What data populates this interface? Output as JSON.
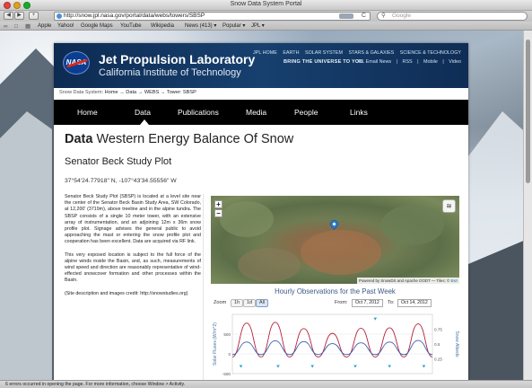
{
  "window": {
    "title": "Snow Data System Portal"
  },
  "toolbar": {
    "back": "◀",
    "forward": "▶",
    "add_bookmark": "+",
    "url": "http://snow.jpl.nasa.gov/portal/data/webs/towers/SBSP",
    "rss": "RSS",
    "reload": "C",
    "search_placeholder": "Google"
  },
  "bookmarks": {
    "items": [
      "Apple",
      "Yahoo!",
      "Google Maps",
      "YouTube",
      "Wikipedia",
      "News (413) ▾",
      "Popular ▾",
      "JPL ▾"
    ]
  },
  "header": {
    "logo_text": "NASA",
    "org_name": "Jet Propulsion Laboratory",
    "org_sub": "California Institute of Technology",
    "top_links": [
      "JPL HOME",
      "EARTH",
      "SOLAR SYSTEM",
      "STARS & GALAXIES",
      "SCIENCE & TECHNOLOGY"
    ],
    "tagline": "BRING THE UNIVERSE TO YOU",
    "util_links": [
      "JPL Email News",
      "|",
      "RSS",
      "|",
      "Mobile",
      "|",
      "Video"
    ]
  },
  "breadcrumb": {
    "root": "Snow Data System",
    "path": ": Home → Data → WEBS → Tower: SBSP"
  },
  "nav": {
    "items": [
      "Home",
      "Data",
      "Publications",
      "Media",
      "People",
      "Links"
    ],
    "active_index": 1
  },
  "content": {
    "title_bold": "Data",
    "title_rest": " Western Energy Balance Of Snow",
    "subtitle": "Senator Beck Study Plot",
    "coords": "37°54'24.77918\" N, -107°43'34.55556\" W",
    "paragraphs": [
      "Senator Beck Study Plot (SBSP) is located at a level site near the center of the Senator Beck Basin Study Area, SW Colorado, at 12,200' (3719m), above treeline and in the alpine tundra. The SBSP consists of a single 10 meter tower, with an extensive array of instrumentation, and an adjoining 12m x 36m snow profile plot. Signage advises the general public to avoid approaching the mast or entering the snow profile plot and cooperation has been excellent. Data are acquired via RF link.",
      "This very exposed location is subject to the full force of the alpine winds inside the Basin, and, as such, measurements of wind speed and direction are reasonably representative of wind-effected snowcover formation and other processes within the Basin.",
      "(Site description and images credit: http://snowstudies.org)"
    ]
  },
  "map": {
    "zoom_in": "+",
    "zoom_out": "−",
    "layers_icon": "≋",
    "attribution_text": "Powered by SnowDS and Apache OODT — Tiles: ©",
    "attribution_link": "Esri"
  },
  "chart_controls": {
    "title": "Hourly Observations for the Past Week",
    "zoom_label": "Zoom",
    "zoom_options": [
      "1h",
      "1d",
      "All"
    ],
    "zoom_selected": "All",
    "from_label": "From:",
    "from_value": "Oct 7, 2012",
    "to_label": "To:",
    "to_value": "Oct 14, 2012"
  },
  "chart_data": {
    "type": "line",
    "title": "Hourly Observations for the Past Week",
    "ylabel": "Solar Fluxes (W/m^2)",
    "y2label": "Snow Albedo",
    "ylim": [
      -500,
      1000
    ],
    "y2lim": [
      0,
      1
    ],
    "yticks": [
      "500",
      "0",
      "-500"
    ],
    "y2ticks": [
      "0.75",
      "0.5",
      "0.25"
    ],
    "x": [
      0,
      0.5,
      1,
      1.5,
      2,
      2.5,
      3,
      3.5,
      4,
      4.5,
      5,
      5.5,
      6,
      6.5,
      7
    ],
    "series": [
      {
        "name": "",
        "color": "#b3223a",
        "values": [
          -80,
          780,
          -80,
          800,
          -80,
          640,
          -80,
          520,
          -80,
          650,
          -80,
          660,
          -80,
          760,
          -80
        ]
      },
      {
        "name": "",
        "color": "#3a5fb0",
        "values": [
          -20,
          300,
          -20,
          330,
          -20,
          310,
          -20,
          260,
          -20,
          280,
          -20,
          300,
          -20,
          340,
          -20
        ]
      }
    ],
    "albedo_markers": [
      0.3,
      1.6,
      2.8,
      4.3,
      5.5,
      6.7
    ],
    "albedo_markers_top": [
      5.0
    ]
  },
  "statusbar": {
    "text": "6 errors occurred in opening the page. For more information, choose Window > Activity."
  }
}
